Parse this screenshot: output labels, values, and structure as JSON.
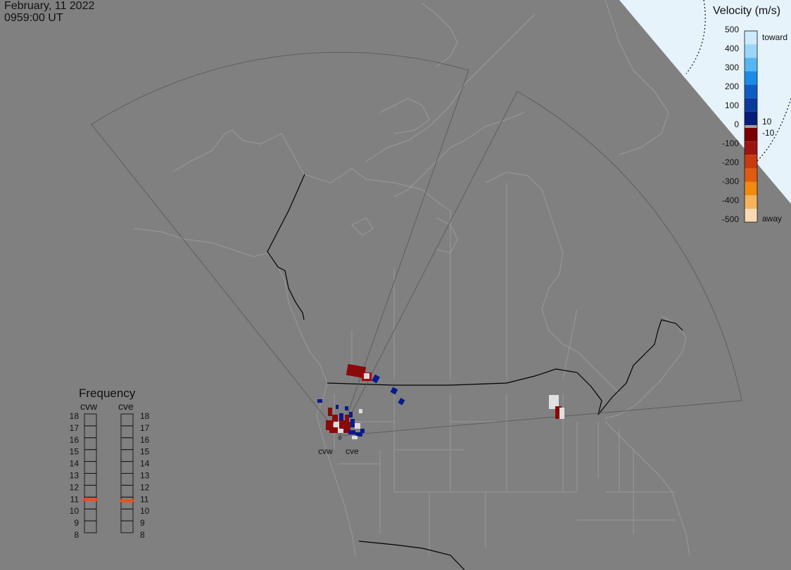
{
  "header": {
    "date": "February, 11 2022",
    "time": "0959:00 UT"
  },
  "radars": [
    {
      "name": "cvw"
    },
    {
      "name": "cve"
    }
  ],
  "velocity_scale": {
    "title": "Velocity (m/s)",
    "ticks": [
      "500",
      "400",
      "300",
      "200",
      "100",
      "0",
      "-100",
      "-200",
      "-300",
      "-400",
      "-500"
    ],
    "threshold_high": "10",
    "threshold_low": "-10",
    "toward_label": "toward",
    "away_label": "away",
    "colors": [
      "#cdeafb",
      "#9bd6fa",
      "#55b6f2",
      "#1b8ce6",
      "#0f5bc4",
      "#0a3a9c",
      "#061e79",
      "#a0a0a0",
      "#7a0000",
      "#9c1410",
      "#c83a10",
      "#e05a10",
      "#f08a10",
      "#f7b35c",
      "#fcd9b0"
    ]
  },
  "frequency_panel": {
    "title": "Frequency",
    "columns": [
      {
        "name": "cvw",
        "active_frequency": 10.8
      },
      {
        "name": "cve",
        "active_frequency": 10.7
      }
    ],
    "levels": [
      "18",
      "17",
      "16",
      "15",
      "14",
      "13",
      "12",
      "11",
      "10",
      "9",
      "8"
    ],
    "marker_color": "#e8501a"
  }
}
